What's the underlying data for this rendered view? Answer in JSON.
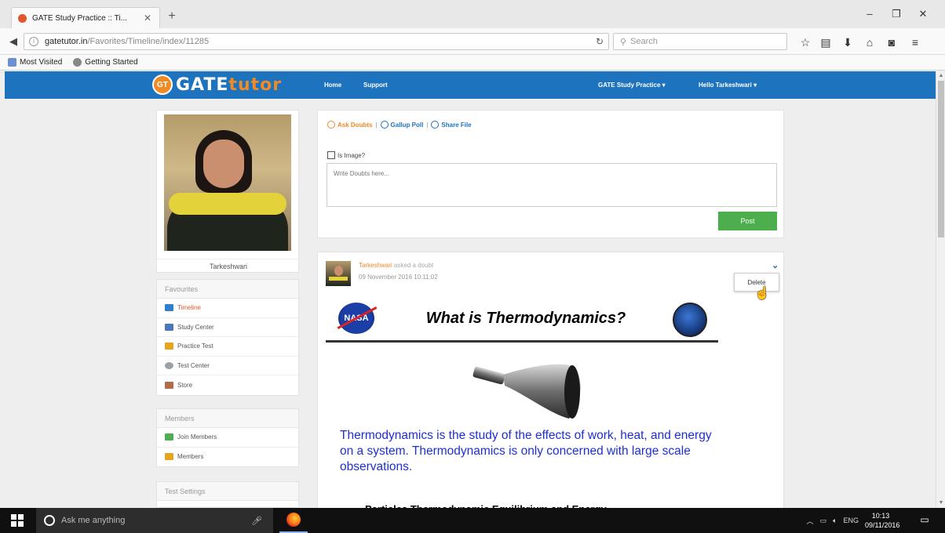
{
  "browser": {
    "tab_title": "GATE Study Practice :: Ti...",
    "tab_close": "✕",
    "new_tab": "+",
    "url_host": "gatetutor.in",
    "url_path": "/Favorites/Timeline/index/11285",
    "search_placeholder": "Search",
    "bookmarks": [
      "Most Visited",
      "Getting Started"
    ]
  },
  "site": {
    "logo_badge": "GT",
    "logo_gate": "GATE",
    "logo_tutor": "tutor",
    "nav": {
      "home": "Home",
      "support": "Support",
      "study_practice": "GATE Study Practice ▾",
      "user_menu": "Hello Tarkeshwari ▾"
    }
  },
  "profile": {
    "name": "Tarkeshwari"
  },
  "sidebar": {
    "favourites_heading": "Favourites",
    "favourites": [
      {
        "label": "Timeline",
        "color": "#2f7fd0"
      },
      {
        "label": "Study Center",
        "color": "#4a78b8"
      },
      {
        "label": "Practice Test",
        "color": "#e8a31f"
      },
      {
        "label": "Test Center",
        "color": "#9aa0a6"
      },
      {
        "label": "Store",
        "color": "#b36b4a"
      }
    ],
    "members_heading": "Members",
    "members": [
      {
        "label": "Join Members",
        "color": "#4caf50"
      },
      {
        "label": "Members",
        "color": "#e8a31f"
      }
    ],
    "test_settings_heading": "Test Settings"
  },
  "composer": {
    "ask_doubts": "Ask Doubts",
    "gallup_poll": "Gallup Poll",
    "share_file": "Share File",
    "separator": "|",
    "is_image_label": "Is Image?",
    "textarea_placeholder": "Write Doubts here...",
    "post_button": "Post"
  },
  "feed": {
    "user": "Tarkeshwari",
    "action": "asked a doubt",
    "timestamp": "09 November 2016 10:11:02",
    "menu_delete": "Delete",
    "image": {
      "nasa_text": "NASA",
      "title": "What is Thermodynamics?",
      "body": "Thermodynamics is the study of the effects of work, heat, and energy on a system. Thermodynamics is only concerned with large scale observations.",
      "sub": "Particles Thermodynamic Equilibrium and Energy"
    }
  },
  "taskbar": {
    "search_placeholder": "Ask me anything",
    "lang": "ENG",
    "time": "10:13",
    "date": "09/11/2016"
  },
  "colors": {
    "header_blue": "#1e73be",
    "accent_orange": "#f08a24",
    "post_green": "#4cae4c",
    "thermo_text_blue": "#1e2fd2"
  }
}
